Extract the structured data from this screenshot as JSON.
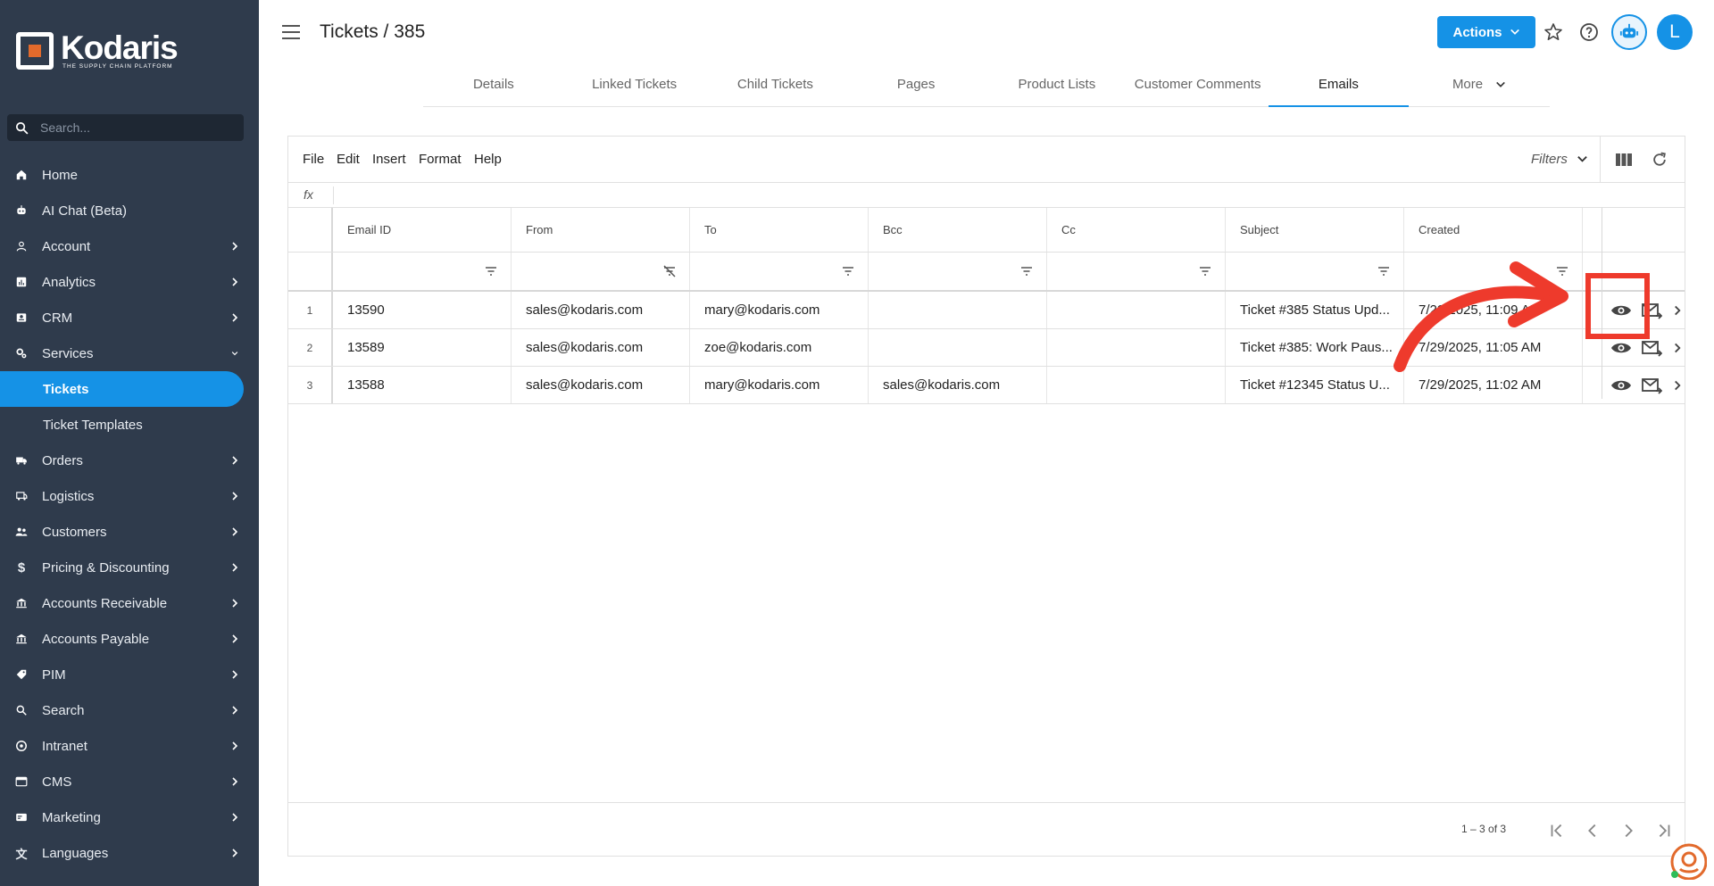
{
  "app": {
    "brand": "Kodaris",
    "tagline": "THE SUPPLY CHAIN PLATFORM"
  },
  "sidebar": {
    "search_placeholder": "Search...",
    "items": [
      {
        "label": "Home",
        "icon": "home-icon"
      },
      {
        "label": "AI Chat (Beta)",
        "icon": "robot-icon"
      },
      {
        "label": "Account",
        "icon": "person-icon"
      },
      {
        "label": "Analytics",
        "icon": "analytics-icon"
      },
      {
        "label": "CRM",
        "icon": "crm-icon"
      },
      {
        "label": "Services",
        "icon": "services-icon"
      },
      {
        "label": "Tickets",
        "icon": ""
      },
      {
        "label": "Ticket Templates",
        "icon": ""
      },
      {
        "label": "Orders",
        "icon": "truck-icon"
      },
      {
        "label": "Logistics",
        "icon": "logistics-icon"
      },
      {
        "label": "Customers",
        "icon": "people-icon"
      },
      {
        "label": "Pricing & Discounting",
        "icon": "dollar-icon"
      },
      {
        "label": "Accounts Receivable",
        "icon": "bank-icon"
      },
      {
        "label": "Accounts Payable",
        "icon": "bank-icon"
      },
      {
        "label": "PIM",
        "icon": "tag-icon"
      },
      {
        "label": "Search",
        "icon": "search-icon"
      },
      {
        "label": "Intranet",
        "icon": "intranet-icon"
      },
      {
        "label": "CMS",
        "icon": "cms-icon"
      },
      {
        "label": "Marketing",
        "icon": "marketing-icon"
      },
      {
        "label": "Languages",
        "icon": "translate-icon"
      }
    ]
  },
  "header": {
    "title": "Tickets / 385",
    "actions_label": "Actions",
    "avatar_initial": "L"
  },
  "tabs": [
    {
      "label": "Details"
    },
    {
      "label": "Linked Tickets"
    },
    {
      "label": "Child Tickets"
    },
    {
      "label": "Pages"
    },
    {
      "label": "Product Lists"
    },
    {
      "label": "Customer Comments"
    },
    {
      "label": "Emails",
      "active": true
    },
    {
      "label": "More"
    }
  ],
  "grid": {
    "menu": [
      "File",
      "Edit",
      "Insert",
      "Format",
      "Help"
    ],
    "filters_label": "Filters",
    "fx_label": "fx",
    "columns": [
      "Email ID",
      "From",
      "To",
      "Bcc",
      "Cc",
      "Subject",
      "Created"
    ],
    "rows": [
      {
        "num": "1",
        "email_id": "13590",
        "from": "sales@kodaris.com",
        "to": "mary@kodaris.com",
        "bcc": "",
        "cc": "",
        "subject": "Ticket #385 Status Upd...",
        "created": "7/29/2025, 11:09 AM"
      },
      {
        "num": "2",
        "email_id": "13589",
        "from": "sales@kodaris.com",
        "to": "zoe@kodaris.com",
        "bcc": "",
        "cc": "",
        "subject": "Ticket #385: Work Paus...",
        "created": "7/29/2025, 11:05 AM"
      },
      {
        "num": "3",
        "email_id": "13588",
        "from": "sales@kodaris.com",
        "to": "mary@kodaris.com",
        "bcc": "sales@kodaris.com",
        "cc": "",
        "subject": "Ticket #12345 Status U...",
        "created": "7/29/2025, 11:02 AM"
      }
    ],
    "page_info": "1 – 3 of 3"
  },
  "colors": {
    "sidebar_bg": "#2f3b4c",
    "accent": "#1592e6",
    "annotation": "#ee3a2c",
    "logo_orange": "#e26a2c"
  }
}
